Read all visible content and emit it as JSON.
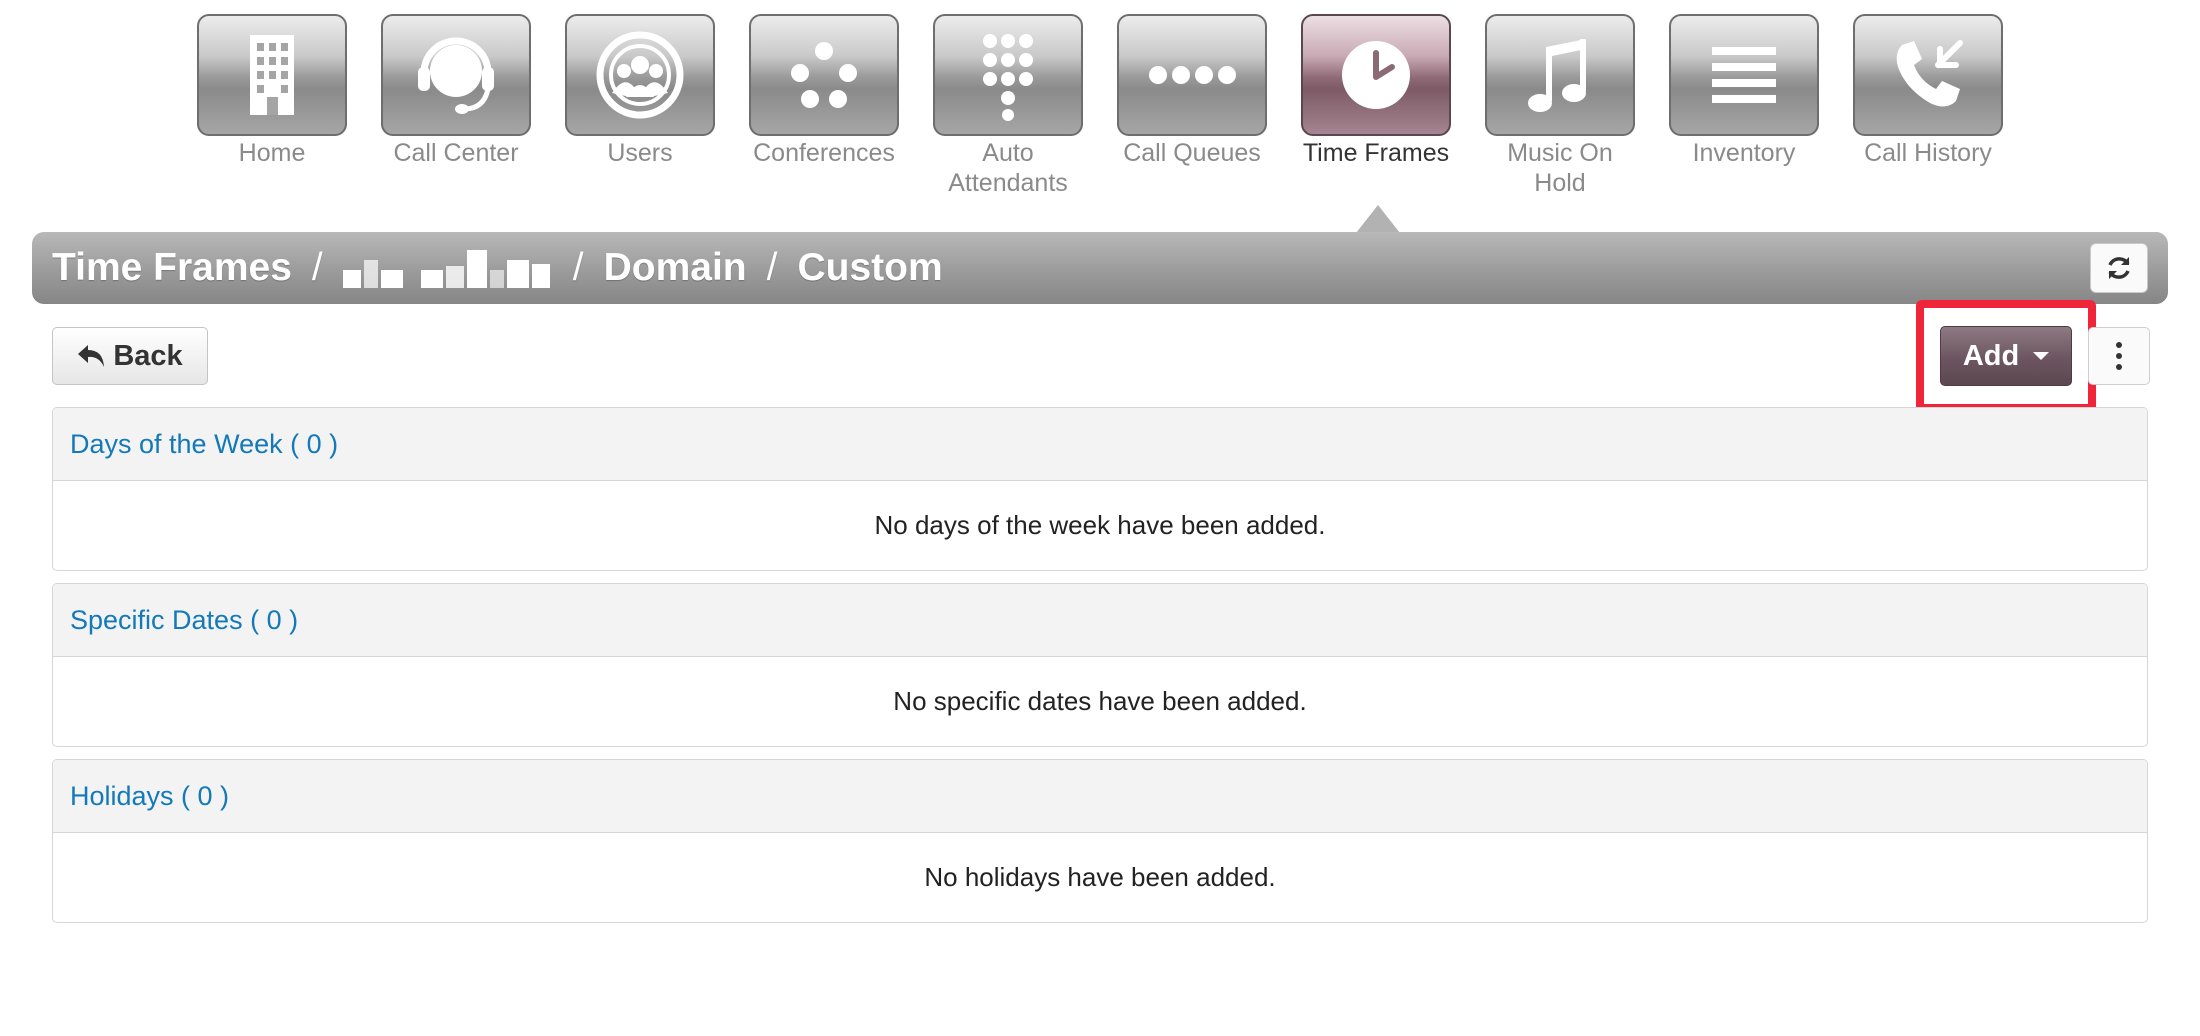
{
  "nav": {
    "items": [
      {
        "label": "Home",
        "icon": "building-icon"
      },
      {
        "label": "Call Center",
        "icon": "headset-icon"
      },
      {
        "label": "Users",
        "icon": "users-icon"
      },
      {
        "label": "Conferences",
        "icon": "conference-icon"
      },
      {
        "label": "Auto Attendants",
        "icon": "keypad-icon"
      },
      {
        "label": "Call Queues",
        "icon": "queue-dots-icon"
      },
      {
        "label": "Time Frames",
        "icon": "clock-icon",
        "active": true
      },
      {
        "label": "Music On Hold",
        "icon": "music-note-icon"
      },
      {
        "label": "Inventory",
        "icon": "list-lines-icon"
      },
      {
        "label": "Call History",
        "icon": "phone-arrows-icon"
      }
    ],
    "active_color": "#7d5a66"
  },
  "breadcrumb": {
    "section": "Time Frames",
    "separator": "/",
    "level2": "Domain",
    "level3": "Custom"
  },
  "toolbar": {
    "back_label": "Back",
    "add_label": "Add",
    "add_color": "#6c5560",
    "highlight_color": "#f0253a"
  },
  "panels": [
    {
      "title": "Days of the Week ( 0 )",
      "empty_text": "No days of the week have been added."
    },
    {
      "title": "Specific Dates ( 0 )",
      "empty_text": "No specific dates have been added."
    },
    {
      "title": "Holidays ( 0 )",
      "empty_text": "No holidays have been added."
    }
  ],
  "colors": {
    "link": "#1379b8",
    "panel_header_bg": "#f3f3f3"
  }
}
